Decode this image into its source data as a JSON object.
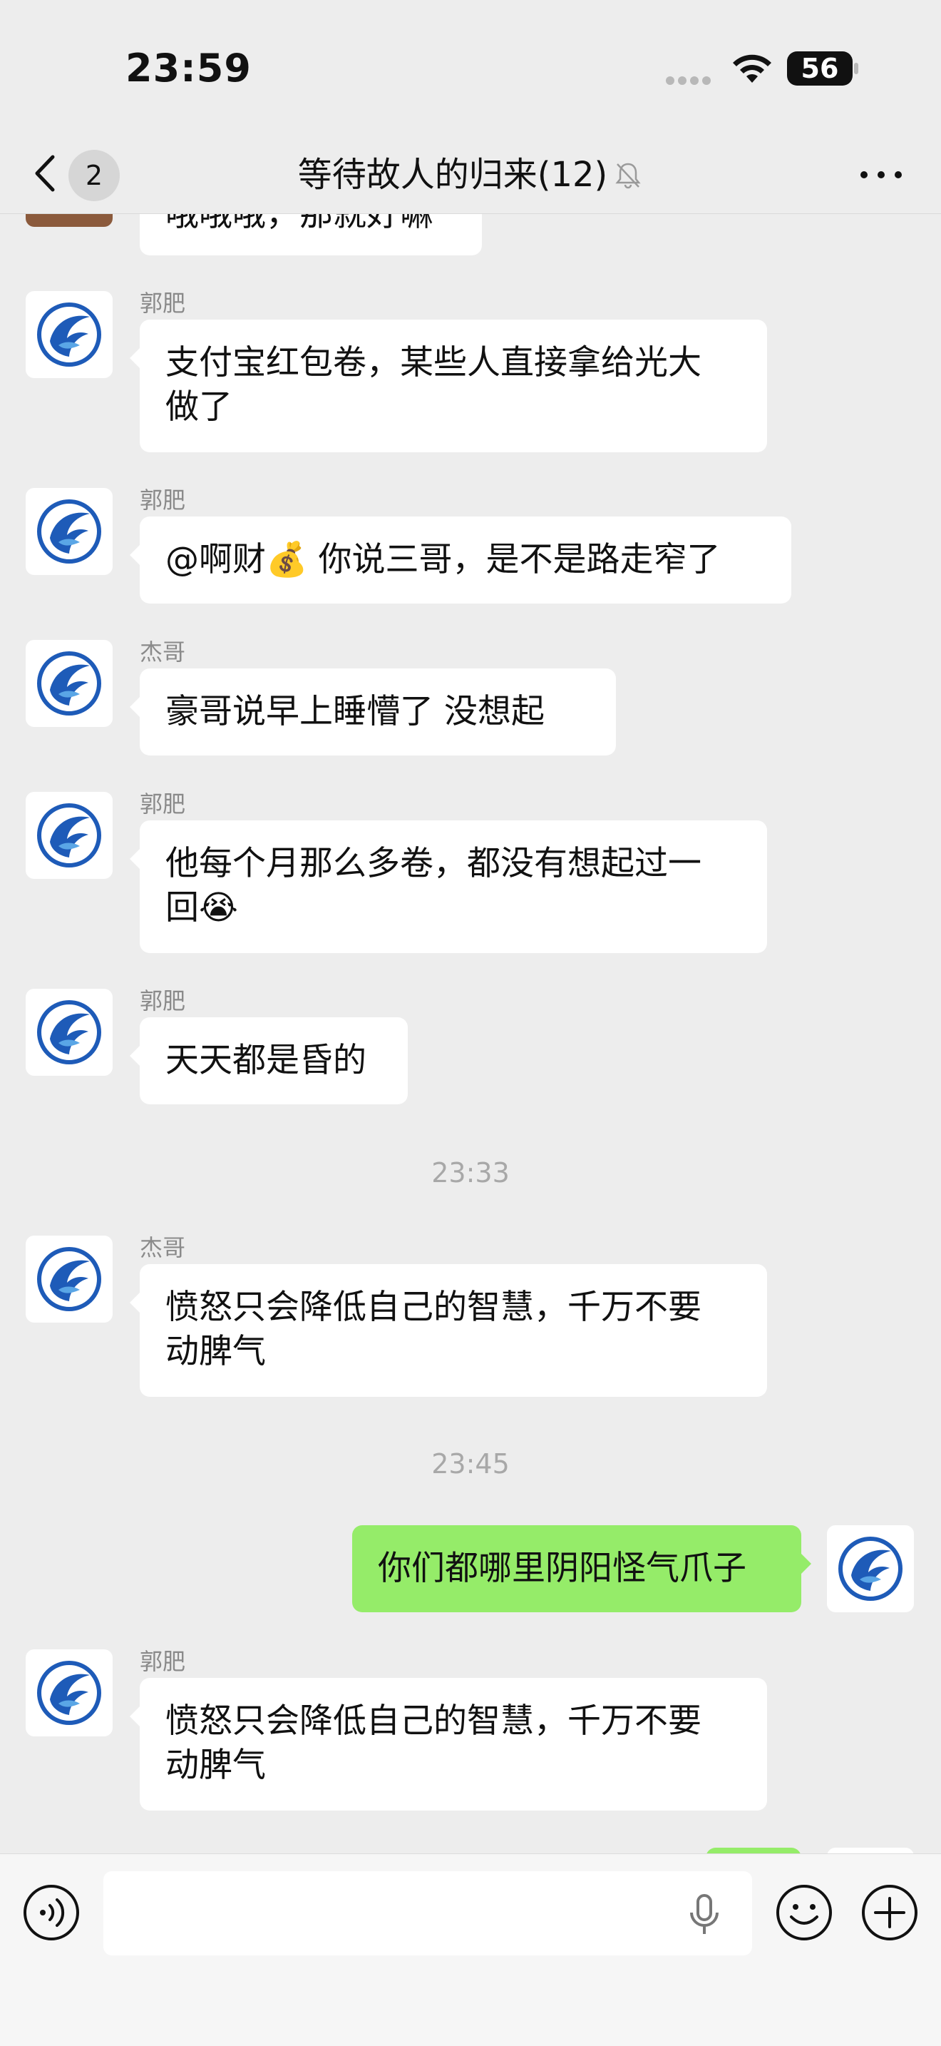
{
  "status_bar": {
    "time": "23:59",
    "battery": "56"
  },
  "nav": {
    "back_count": "2",
    "title": "等待故人的归来(12)"
  },
  "chat": {
    "partial_message": "哦哦哦，那就好嘛",
    "messages": [
      {
        "sender": "郭肥",
        "line1": "支付宝红包卷，某些人直接拿给光大",
        "line2": "做了"
      },
      {
        "sender": "郭肥",
        "line1": "@啊财💰 你说三哥，是不是路走窄了"
      },
      {
        "sender": "杰哥",
        "line1": "豪哥说早上睡懵了  没想起"
      },
      {
        "sender": "郭肥",
        "line1": "他每个月那么多卷，都没有想起过一",
        "line2": "回😭"
      },
      {
        "sender": "郭肥",
        "line1": "天天都是昏的"
      },
      {
        "sender": "杰哥",
        "line1": "愤怒只会降低自己的智慧，千万不要",
        "line2": "动脾气"
      },
      {
        "sender": "郭肥",
        "line1": "愤怒只会降低自己的智慧，千万不要",
        "line2": "动脾气"
      }
    ],
    "time_separators": [
      "23:33",
      "23:45"
    ],
    "my_message": "你们都哪里阴阳怪气爪子"
  },
  "input": {
    "placeholder": ""
  },
  "colors": {
    "background": "#EDEDED",
    "bubble_incoming": "#FFFFFF",
    "bubble_outgoing": "#95EC69",
    "avatar_logo": "#1E5BB8"
  },
  "icons": [
    "back-icon",
    "mute-bell-icon",
    "more-icon",
    "wifi-icon",
    "voice-icon",
    "mic-icon",
    "emoji-icon",
    "plus-icon"
  ]
}
